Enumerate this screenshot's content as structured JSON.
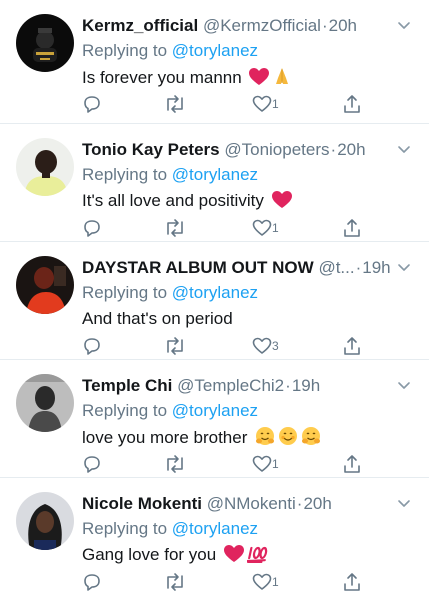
{
  "tweets": [
    {
      "name": "Kermz_official",
      "handle": "@KermzOfficial",
      "separator": "·",
      "time": "20h",
      "replying_prefix": "Replying to ",
      "replying_to": "@torylanez",
      "text": "Is forever you mannn",
      "emojis": [
        "heart-emoji",
        "pray-emoji"
      ],
      "likes": "1"
    },
    {
      "name": "Tonio Kay Peters",
      "handle": "@Toniopeters",
      "separator": "·",
      "time": "20h",
      "replying_prefix": "Replying to ",
      "replying_to": "@torylanez",
      "text": "It's all love and positivity",
      "emojis": [
        "heart-emoji"
      ],
      "likes": "1"
    },
    {
      "name": "DAYSTAR ALBUM OUT NOW",
      "handle": "@t...",
      "separator": "·",
      "time": "19h",
      "replying_prefix": "Replying to ",
      "replying_to": "@torylanez",
      "text": "And that's on period",
      "emojis": [],
      "likes": "3"
    },
    {
      "name": "Temple Chi",
      "handle": "@TempleChi2",
      "separator": "·",
      "time": "19h",
      "replying_prefix": "Replying to ",
      "replying_to": "@torylanez",
      "text": "love you more brother",
      "emojis": [
        "hugging-emoji",
        "smiling-emoji",
        "hugging-emoji"
      ],
      "likes": "1"
    },
    {
      "name": "Nicole Mokenti",
      "handle": "@NMokenti",
      "separator": "·",
      "time": "20h",
      "replying_prefix": "Replying to ",
      "replying_to": "@torylanez",
      "text": "Gang love for you",
      "emojis": [
        "heart-emoji",
        "hundred-points-emoji"
      ],
      "likes": "1"
    }
  ],
  "colors": {
    "text": "#14171a",
    "secondary": "#657786",
    "link": "#1da1f2",
    "divider": "#e6ecf0"
  },
  "icons": {
    "reply": "reply-icon",
    "retweet": "retweet-icon",
    "like": "heart-outline-icon",
    "share": "share-icon",
    "more": "chevron-down-icon"
  }
}
